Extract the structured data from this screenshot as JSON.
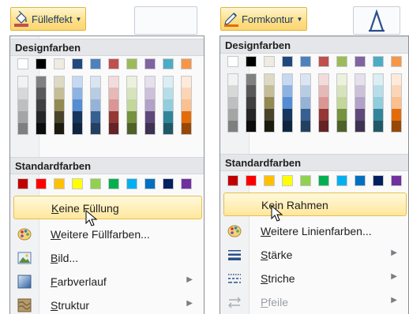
{
  "colors": {
    "theme_rows": [
      [
        "#ffffff",
        "#000000",
        "#eeece1",
        "#1f497d",
        "#4f81bd",
        "#c0504d",
        "#9bbb59",
        "#8064a2",
        "#4bacc6",
        "#f79646"
      ],
      [
        "#f2f2f2",
        "#808080",
        "#ddd9c3",
        "#c6d9f0",
        "#dbe5f1",
        "#f2dcdb",
        "#ebf1dd",
        "#e5e0ec",
        "#dbeef3",
        "#fdeada"
      ],
      [
        "#d8d8d8",
        "#595959",
        "#c4bd97",
        "#8db3e2",
        "#b8cce4",
        "#e5b9b7",
        "#d7e3bc",
        "#ccc1d9",
        "#b7dde8",
        "#fbd5b5"
      ],
      [
        "#bfbfbf",
        "#3f3f3f",
        "#938953",
        "#548dd4",
        "#95b3d7",
        "#d99694",
        "#c3d69b",
        "#b2a2c7",
        "#92cddc",
        "#fac08f"
      ],
      [
        "#a5a5a5",
        "#262626",
        "#494429",
        "#17365d",
        "#366092",
        "#953734",
        "#76923c",
        "#5f497a",
        "#31859b",
        "#e36c09"
      ],
      [
        "#7f7f7f",
        "#0c0c0c",
        "#1d1b10",
        "#0f243e",
        "#244061",
        "#632423",
        "#4f6128",
        "#3f3151",
        "#205867",
        "#974806"
      ]
    ],
    "standard_row": [
      "#c00000",
      "#ff0000",
      "#ffc000",
      "#ffff00",
      "#92d050",
      "#00b050",
      "#00b0f0",
      "#0070c0",
      "#002060",
      "#7030a0"
    ]
  },
  "left": {
    "button_label": "Fülleffekt",
    "button_icon": "paint-bucket-icon",
    "section_theme": "Designfarben",
    "section_standard": "Standardfarben",
    "items": [
      {
        "name": "no-fill",
        "icon": "none",
        "pre": "",
        "key": "K",
        "post": "eine Füllung",
        "highlighted": true,
        "submenu": false
      },
      {
        "name": "more-fill-colors",
        "icon": "color-palette-icon",
        "pre": "",
        "key": "W",
        "post": "eitere Füllfarben...",
        "highlighted": false,
        "submenu": false
      },
      {
        "name": "picture",
        "icon": "picture-icon",
        "pre": "",
        "key": "B",
        "post": "ild...",
        "highlighted": false,
        "submenu": false
      },
      {
        "name": "gradient",
        "icon": "gradient-icon",
        "pre": "",
        "key": "F",
        "post": "arbverlauf",
        "highlighted": false,
        "submenu": true
      },
      {
        "name": "texture",
        "icon": "texture-icon",
        "pre": "",
        "key": "S",
        "post": "truktur",
        "highlighted": false,
        "submenu": true
      }
    ]
  },
  "right": {
    "button_label": "Formkontur",
    "button_icon": "pen-outline-icon",
    "section_theme": "Designfarben",
    "section_standard": "Standardfarben",
    "items": [
      {
        "name": "no-outline",
        "icon": "none",
        "pre": "Ke",
        "key": "i",
        "post": "n Rahmen",
        "highlighted": true,
        "submenu": false,
        "disabled": false
      },
      {
        "name": "more-line-colors",
        "icon": "color-palette-icon",
        "pre": "",
        "key": "W",
        "post": "eitere Linienfarben...",
        "highlighted": false,
        "submenu": false,
        "disabled": false
      },
      {
        "name": "weight",
        "icon": "line-weight-icon",
        "pre": "",
        "key": "S",
        "post": "tärke",
        "highlighted": false,
        "submenu": true,
        "disabled": false
      },
      {
        "name": "dashes",
        "icon": "dash-style-icon",
        "pre": "",
        "key": "S",
        "post": "triche",
        "highlighted": false,
        "submenu": true,
        "disabled": false
      },
      {
        "name": "arrows",
        "icon": "arrows-icon",
        "pre": "",
        "key": "P",
        "post": "feile",
        "highlighted": false,
        "submenu": true,
        "disabled": true
      }
    ]
  }
}
